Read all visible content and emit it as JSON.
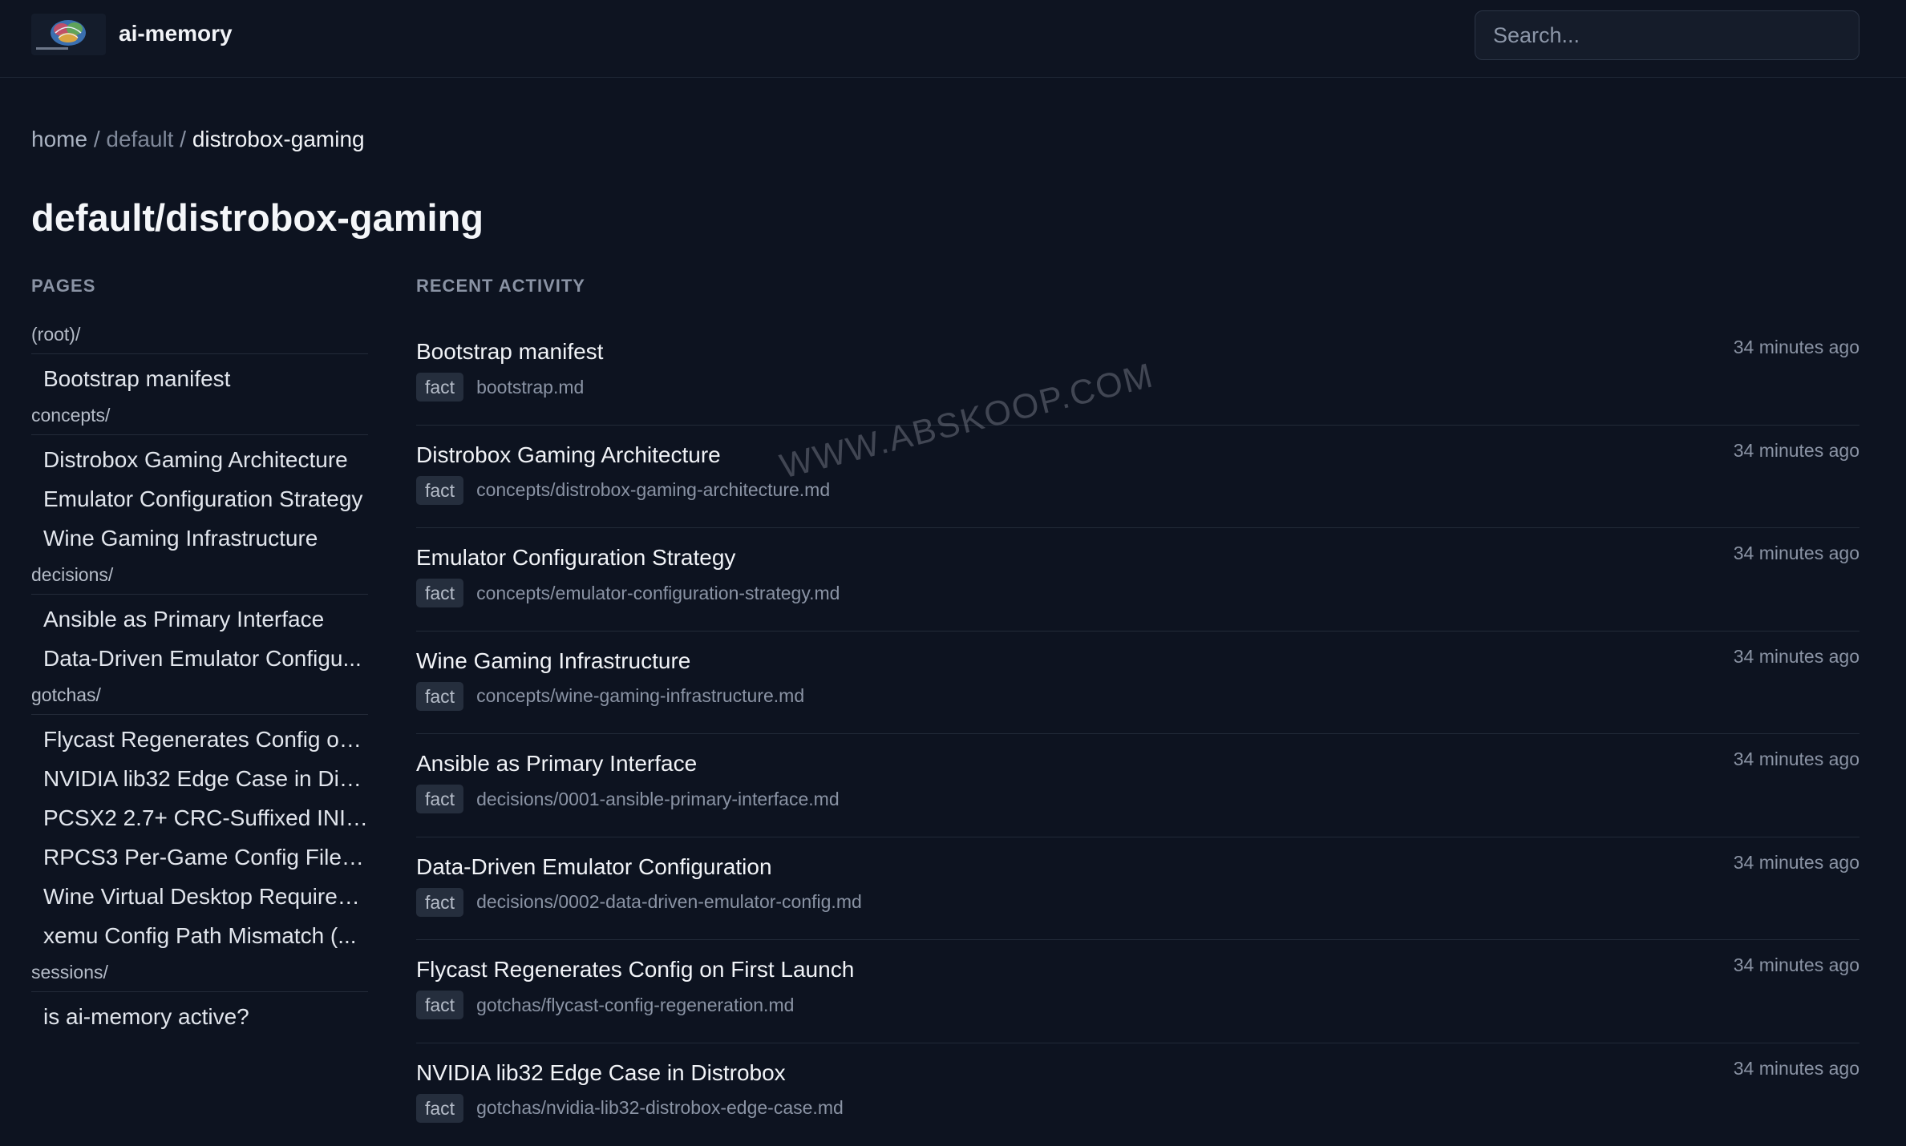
{
  "header": {
    "app_title": "ai-memory",
    "logo_icon": "brain-logo-icon",
    "search_placeholder": "Search..."
  },
  "breadcrumb": {
    "home": "home",
    "sep1": "/",
    "default": "default",
    "sep2": "/",
    "current": "distrobox-gaming"
  },
  "page_title": "default/distrobox-gaming",
  "pages": {
    "label": "PAGES",
    "groups": [
      {
        "label": "(root)/",
        "items": [
          "Bootstrap manifest"
        ]
      },
      {
        "label": "concepts/",
        "items": [
          "Distrobox Gaming Architecture",
          "Emulator Configuration Strategy",
          "Wine Gaming Infrastructure"
        ]
      },
      {
        "label": "decisions/",
        "items": [
          "Ansible as Primary Interface",
          "Data-Driven Emulator Configu..."
        ]
      },
      {
        "label": "gotchas/",
        "items": [
          "Flycast Regenerates Config on...",
          "NVIDIA lib32 Edge Case in Dis...",
          "PCSX2 2.7+ CRC-Suffixed INI ...",
          "RPCS3 Per-Game Config Filen...",
          "Wine Virtual Desktop Required...",
          "xemu Config Path Mismatch (..."
        ]
      },
      {
        "label": "sessions/",
        "items": [
          "is ai-memory active?"
        ]
      }
    ]
  },
  "activity": {
    "label": "RECENT ACTIVITY",
    "items": [
      {
        "title": "Bootstrap manifest",
        "tag": "fact",
        "path": "bootstrap.md",
        "time": "34 minutes ago"
      },
      {
        "title": "Distrobox Gaming Architecture",
        "tag": "fact",
        "path": "concepts/distrobox-gaming-architecture.md",
        "time": "34 minutes ago"
      },
      {
        "title": "Emulator Configuration Strategy",
        "tag": "fact",
        "path": "concepts/emulator-configuration-strategy.md",
        "time": "34 minutes ago"
      },
      {
        "title": "Wine Gaming Infrastructure",
        "tag": "fact",
        "path": "concepts/wine-gaming-infrastructure.md",
        "time": "34 minutes ago"
      },
      {
        "title": "Ansible as Primary Interface",
        "tag": "fact",
        "path": "decisions/0001-ansible-primary-interface.md",
        "time": "34 minutes ago"
      },
      {
        "title": "Data-Driven Emulator Configuration",
        "tag": "fact",
        "path": "decisions/0002-data-driven-emulator-config.md",
        "time": "34 minutes ago"
      },
      {
        "title": "Flycast Regenerates Config on First Launch",
        "tag": "fact",
        "path": "gotchas/flycast-config-regeneration.md",
        "time": "34 minutes ago"
      },
      {
        "title": "NVIDIA lib32 Edge Case in Distrobox",
        "tag": "fact",
        "path": "gotchas/nvidia-lib32-distrobox-edge-case.md",
        "time": "34 minutes ago"
      }
    ]
  },
  "watermark": "WWW.ABSKOOP.COM"
}
